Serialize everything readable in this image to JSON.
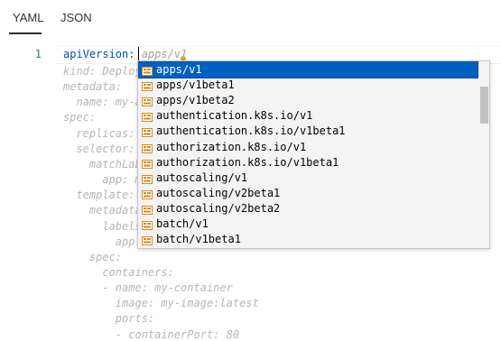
{
  "tabs": [
    {
      "label": "YAML",
      "active": true
    },
    {
      "label": "JSON",
      "active": false
    }
  ],
  "editor": {
    "line_number": "1",
    "first_line": {
      "key": "apiVersion: ",
      "placeholder": "apps/v1"
    },
    "lines": [
      "kind: Deploy",
      "metadata:",
      "  name: my-a",
      "spec:",
      "  replicas:",
      "  selector:",
      "    matchLab",
      "      app: m",
      "  template:",
      "    metadata",
      "      labels",
      "        app:",
      "    spec:",
      "      containers:",
      "      - name: my-container",
      "        image: my-image:latest",
      "        ports:",
      "        - containerPort: 80"
    ]
  },
  "suggestions": {
    "selected_index": 0,
    "icon": "property-icon",
    "items": [
      "apps/v1",
      "apps/v1beta1",
      "apps/v1beta2",
      "authentication.k8s.io/v1",
      "authentication.k8s.io/v1beta1",
      "authorization.k8s.io/v1",
      "authorization.k8s.io/v1beta1",
      "autoscaling/v1",
      "autoscaling/v2beta1",
      "autoscaling/v2beta2",
      "batch/v1",
      "batch/v1beta1"
    ]
  },
  "colors": {
    "selection": "#0060c0",
    "icon_accent": "#d68a1f",
    "line_number": "#237893"
  }
}
